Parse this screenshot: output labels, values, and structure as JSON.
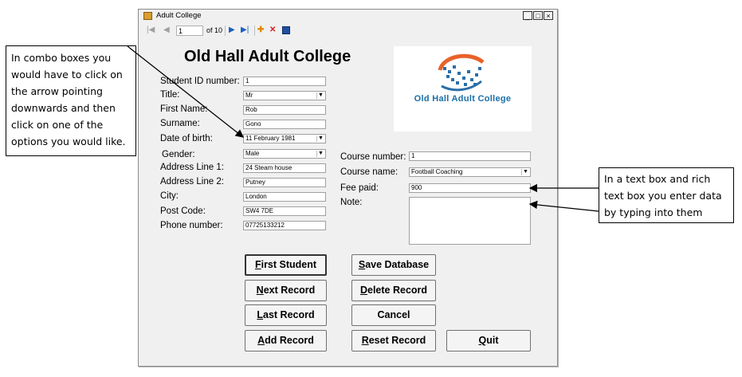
{
  "window": {
    "title": "Adult College",
    "controls": {
      "minimize": "_",
      "maximize": "□",
      "close": "×"
    }
  },
  "navigator": {
    "position": "1",
    "count_label": "of 10",
    "icons": [
      "move-first-icon",
      "move-previous-icon",
      "move-next-icon",
      "move-last-icon",
      "add-new-icon",
      "delete-icon",
      "save-icon"
    ]
  },
  "heading": "Old Hall Adult College",
  "logo_text": "Old Hall Adult College",
  "student": {
    "id_label": "Student ID number:",
    "id_value": "1",
    "title_label": "Title:",
    "title_value": "Mr",
    "first_name_label": "First Name:",
    "first_name_value": "Rob",
    "surname_label": "Surname:",
    "surname_value": "Gono",
    "dob_label": "Date of birth:",
    "dob_value": "11  February  1981",
    "gender_label": "Gender:",
    "gender_value": "Male",
    "address1_label": "Address Line 1:",
    "address1_value": "24 Steam house",
    "address2_label": "Address Line 2:",
    "address2_value": "Putney",
    "city_label": "City:",
    "city_value": "London",
    "postcode_label": "Post Code:",
    "postcode_value": "SW4  7DE",
    "phone_label": "Phone number:",
    "phone_value": "07725133212"
  },
  "course": {
    "number_label": "Course number:",
    "number_value": "1",
    "name_label": "Course name:",
    "name_value": "Football Coaching",
    "fee_label": "Fee paid:",
    "fee_value": "900",
    "note_label": "Note:",
    "note_value": ""
  },
  "buttons": {
    "first_student": {
      "mnemonic": "F",
      "rest": "irst Student"
    },
    "next_record": {
      "mnemonic": "N",
      "rest": "ext Record"
    },
    "last_record": {
      "mnemonic": "L",
      "rest": "ast Record"
    },
    "add_record": {
      "mnemonic": "A",
      "rest": "dd Record"
    },
    "save_database": {
      "mnemonic": "S",
      "rest": "ave Database"
    },
    "delete_record": {
      "mnemonic": "D",
      "rest": "elete Record"
    },
    "cancel": "Cancel",
    "reset_record": {
      "mnemonic": "R",
      "rest": "eset Record"
    },
    "quit": {
      "mnemonic": "Q",
      "rest": "uit"
    }
  },
  "callouts": {
    "left": "In combo boxes you would have to click on the arrow pointing downwards and then click on one of the options you would like.",
    "right": "In a text box and rich text box you enter data by typing into them"
  },
  "colors": {
    "window_bg": "#f0f0f0",
    "logo_text": "#1a6fa8",
    "logo_swoosh": "#e8632a",
    "logo_dots": "#2a6fa8"
  }
}
